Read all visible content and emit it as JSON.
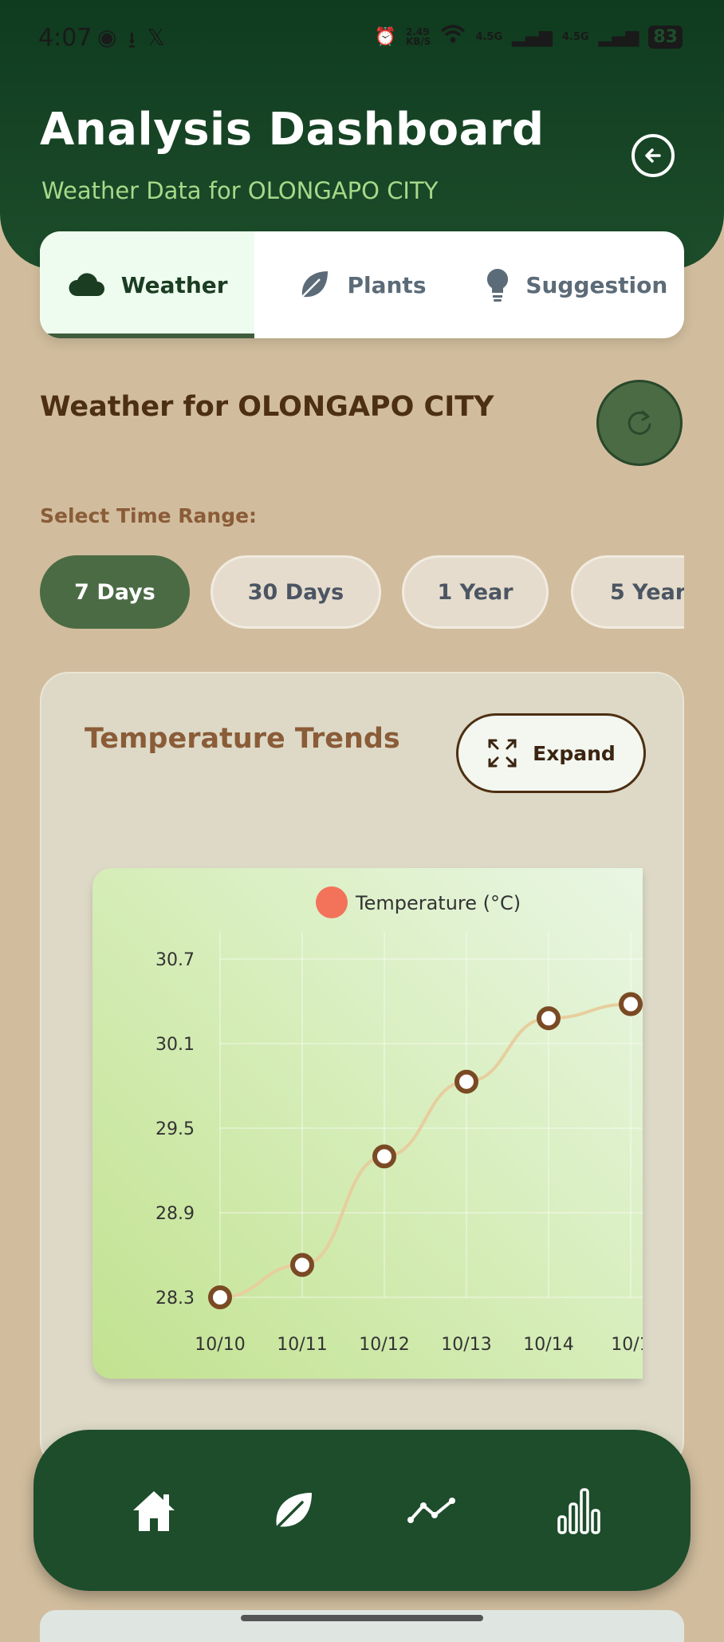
{
  "status_bar": {
    "time": "4:07",
    "net_speed_top": "2.49",
    "net_speed_bottom": "KB/S",
    "signal1": "4.5G",
    "signal2": "4.5G",
    "battery": "83"
  },
  "header": {
    "title": "Analysis Dashboard",
    "subtitle": "Weather Data for OLONGAPO CITY"
  },
  "tabs": [
    {
      "label": "Weather",
      "icon": "cloud-icon",
      "active": true
    },
    {
      "label": "Plants",
      "icon": "leaf-icon",
      "active": false
    },
    {
      "label": "Suggestion",
      "icon": "lightbulb-icon",
      "active": false
    }
  ],
  "section": {
    "title": "Weather for OLONGAPO CITY"
  },
  "time_range": {
    "label": "Select Time Range:",
    "options": [
      "7 Days",
      "30 Days",
      "1 Year",
      "5 Year"
    ],
    "selected": "7 Days"
  },
  "card": {
    "title": "Temperature Trends",
    "expand_label": "Expand"
  },
  "chart_data": {
    "type": "line",
    "legend": [
      "Temperature (°C)"
    ],
    "legend_position": "top-center",
    "series": [
      {
        "name": "Temperature (°C)",
        "color": "#f2735a",
        "line_color": "#e7ce9e",
        "point_color": "#7a4a24",
        "values": [
          28.3,
          28.53,
          29.3,
          29.83,
          30.28,
          30.38
        ]
      }
    ],
    "categories": [
      "10/10",
      "10/11",
      "10/12",
      "10/13",
      "10/14",
      "10/1"
    ],
    "y_ticks": [
      30.7,
      30.1,
      29.5,
      28.9,
      28.3
    ],
    "ylim": [
      28.3,
      30.7
    ],
    "grid": true
  },
  "bottom_nav": {
    "items": [
      "home-icon",
      "leaf-icon",
      "trend-icon",
      "bar-chart-icon"
    ]
  }
}
